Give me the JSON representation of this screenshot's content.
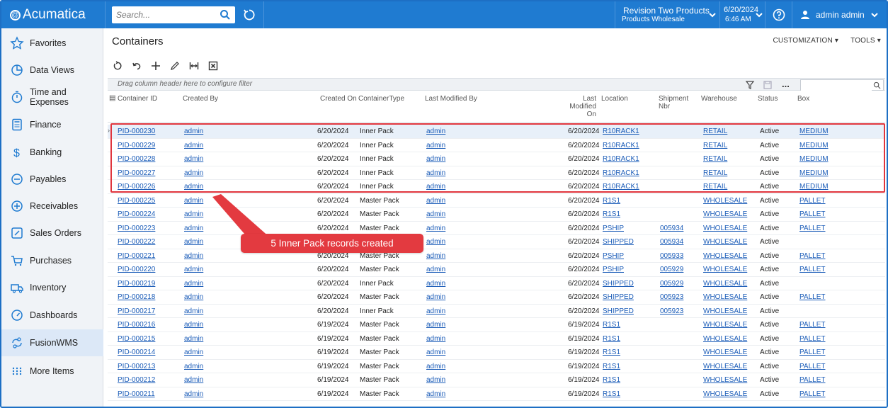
{
  "app": {
    "logo_text": "Acumatica"
  },
  "topbar": {
    "search_placeholder": "Search...",
    "company_line1": "Revision Two Products",
    "company_line2": "Products Wholesale",
    "date": "6/20/2024",
    "time": "6:46 AM",
    "user": "admin admin"
  },
  "sidebar": {
    "items": [
      {
        "label": "Favorites",
        "icon": "star-icon"
      },
      {
        "label": "Data Views",
        "icon": "pie-chart-icon"
      },
      {
        "label": "Time and Expenses",
        "icon": "stopwatch-icon"
      },
      {
        "label": "Finance",
        "icon": "calculator-icon"
      },
      {
        "label": "Banking",
        "icon": "dollar-icon"
      },
      {
        "label": "Payables",
        "icon": "minus-circle-icon"
      },
      {
        "label": "Receivables",
        "icon": "plus-circle-icon"
      },
      {
        "label": "Sales Orders",
        "icon": "pencil-icon"
      },
      {
        "label": "Purchases",
        "icon": "cart-icon"
      },
      {
        "label": "Inventory",
        "icon": "truck-icon"
      },
      {
        "label": "Dashboards",
        "icon": "gauge-icon"
      },
      {
        "label": "FusionWMS",
        "icon": "wms-icon"
      },
      {
        "label": "More Items",
        "icon": "grid-dots-icon"
      }
    ],
    "active": "FusionWMS"
  },
  "page": {
    "title": "Containers",
    "customization": "CUSTOMIZATION ▾",
    "tools": "TOOLS ▾",
    "filter_hint": "Drag column header here to configure filter",
    "more": "..."
  },
  "columns": {
    "container_id": "Container ID",
    "created_by": "Created By",
    "created_on": "Created On",
    "container_type": "ContainerType",
    "last_modified_by": "Last Modified By",
    "last_modified_on_1": "Last",
    "last_modified_on_2": "Modified",
    "last_modified_on_3": "On",
    "location": "Location",
    "shipment_nbr_1": "Shipment",
    "shipment_nbr_2": "Nbr",
    "warehouse": "Warehouse",
    "status": "Status",
    "box": "Box"
  },
  "rows": [
    {
      "id": "PID-000230",
      "created_by": "admin",
      "created_on": "6/20/2024",
      "type": "Inner Pack",
      "modified_by": "admin",
      "modified_on": "6/20/2024",
      "location": "R10RACK1",
      "shipment": "",
      "warehouse": "RETAIL",
      "status": "Active",
      "box": "MEDIUM"
    },
    {
      "id": "PID-000229",
      "created_by": "admin",
      "created_on": "6/20/2024",
      "type": "Inner Pack",
      "modified_by": "admin",
      "modified_on": "6/20/2024",
      "location": "R10RACK1",
      "shipment": "",
      "warehouse": "RETAIL",
      "status": "Active",
      "box": "MEDIUM"
    },
    {
      "id": "PID-000228",
      "created_by": "admin",
      "created_on": "6/20/2024",
      "type": "Inner Pack",
      "modified_by": "admin",
      "modified_on": "6/20/2024",
      "location": "R10RACK1",
      "shipment": "",
      "warehouse": "RETAIL",
      "status": "Active",
      "box": "MEDIUM"
    },
    {
      "id": "PID-000227",
      "created_by": "admin",
      "created_on": "6/20/2024",
      "type": "Inner Pack",
      "modified_by": "admin",
      "modified_on": "6/20/2024",
      "location": "R10RACK1",
      "shipment": "",
      "warehouse": "RETAIL",
      "status": "Active",
      "box": "MEDIUM"
    },
    {
      "id": "PID-000226",
      "created_by": "admin",
      "created_on": "6/20/2024",
      "type": "Inner Pack",
      "modified_by": "admin",
      "modified_on": "6/20/2024",
      "location": "R10RACK1",
      "shipment": "",
      "warehouse": "RETAIL",
      "status": "Active",
      "box": "MEDIUM"
    },
    {
      "id": "PID-000225",
      "created_by": "admin",
      "created_on": "6/20/2024",
      "type": "Master Pack",
      "modified_by": "admin",
      "modified_on": "6/20/2024",
      "location": "R1S1",
      "shipment": "",
      "warehouse": "WHOLESALE",
      "status": "Active",
      "box": "PALLET"
    },
    {
      "id": "PID-000224",
      "created_by": "admin",
      "created_on": "6/20/2024",
      "type": "Master Pack",
      "modified_by": "admin",
      "modified_on": "6/20/2024",
      "location": "R1S1",
      "shipment": "",
      "warehouse": "WHOLESALE",
      "status": "Active",
      "box": "PALLET"
    },
    {
      "id": "PID-000223",
      "created_by": "admin",
      "created_on": "6/20/2024",
      "type": "Master Pack",
      "modified_by": "admin",
      "modified_on": "6/20/2024",
      "location": "PSHIP",
      "shipment": "005934",
      "warehouse": "WHOLESALE",
      "status": "Active",
      "box": "PALLET"
    },
    {
      "id": "PID-000222",
      "created_by": "admin",
      "created_on": "6/20/2024",
      "type": "Master Pack",
      "modified_by": "admin",
      "modified_on": "6/20/2024",
      "location": "SHIPPED",
      "shipment": "005934",
      "warehouse": "WHOLESALE",
      "status": "Active",
      "box": ""
    },
    {
      "id": "PID-000221",
      "created_by": "admin",
      "created_on": "6/20/2024",
      "type": "Master Pack",
      "modified_by": "admin",
      "modified_on": "6/20/2024",
      "location": "PSHIP",
      "shipment": "005933",
      "warehouse": "WHOLESALE",
      "status": "Active",
      "box": "PALLET"
    },
    {
      "id": "PID-000220",
      "created_by": "admin",
      "created_on": "6/20/2024",
      "type": "Master Pack",
      "modified_by": "admin",
      "modified_on": "6/20/2024",
      "location": "PSHIP",
      "shipment": "005929",
      "warehouse": "WHOLESALE",
      "status": "Active",
      "box": "PALLET"
    },
    {
      "id": "PID-000219",
      "created_by": "admin",
      "created_on": "6/20/2024",
      "type": "Inner Pack",
      "modified_by": "admin",
      "modified_on": "6/20/2024",
      "location": "SHIPPED",
      "shipment": "005929",
      "warehouse": "WHOLESALE",
      "status": "Active",
      "box": ""
    },
    {
      "id": "PID-000218",
      "created_by": "admin",
      "created_on": "6/20/2024",
      "type": "Master Pack",
      "modified_by": "admin",
      "modified_on": "6/20/2024",
      "location": "SHIPPED",
      "shipment": "005923",
      "warehouse": "WHOLESALE",
      "status": "Active",
      "box": "PALLET"
    },
    {
      "id": "PID-000217",
      "created_by": "admin",
      "created_on": "6/20/2024",
      "type": "Inner Pack",
      "modified_by": "admin",
      "modified_on": "6/20/2024",
      "location": "SHIPPED",
      "shipment": "005923",
      "warehouse": "WHOLESALE",
      "status": "Active",
      "box": ""
    },
    {
      "id": "PID-000216",
      "created_by": "admin",
      "created_on": "6/19/2024",
      "type": "Master Pack",
      "modified_by": "admin",
      "modified_on": "6/19/2024",
      "location": "R1S1",
      "shipment": "",
      "warehouse": "WHOLESALE",
      "status": "Active",
      "box": "PALLET"
    },
    {
      "id": "PID-000215",
      "created_by": "admin",
      "created_on": "6/19/2024",
      "type": "Master Pack",
      "modified_by": "admin",
      "modified_on": "6/19/2024",
      "location": "R1S1",
      "shipment": "",
      "warehouse": "WHOLESALE",
      "status": "Active",
      "box": "PALLET"
    },
    {
      "id": "PID-000214",
      "created_by": "admin",
      "created_on": "6/19/2024",
      "type": "Master Pack",
      "modified_by": "admin",
      "modified_on": "6/19/2024",
      "location": "R1S1",
      "shipment": "",
      "warehouse": "WHOLESALE",
      "status": "Active",
      "box": "PALLET"
    },
    {
      "id": "PID-000213",
      "created_by": "admin",
      "created_on": "6/19/2024",
      "type": "Master Pack",
      "modified_by": "admin",
      "modified_on": "6/19/2024",
      "location": "R1S1",
      "shipment": "",
      "warehouse": "WHOLESALE",
      "status": "Active",
      "box": "PALLET"
    },
    {
      "id": "PID-000212",
      "created_by": "admin",
      "created_on": "6/19/2024",
      "type": "Master Pack",
      "modified_by": "admin",
      "modified_on": "6/19/2024",
      "location": "R1S1",
      "shipment": "",
      "warehouse": "WHOLESALE",
      "status": "Active",
      "box": "PALLET"
    },
    {
      "id": "PID-000211",
      "created_by": "admin",
      "created_on": "6/19/2024",
      "type": "Master Pack",
      "modified_by": "admin",
      "modified_on": "6/19/2024",
      "location": "R1S1",
      "shipment": "",
      "warehouse": "WHOLESALE",
      "status": "Active",
      "box": "PALLET"
    }
  ],
  "annotation": {
    "callout_text": "5 Inner Pack records created",
    "color": "#e33a40"
  },
  "colors": {
    "topbar": "#1f7bd1",
    "link": "#1b5cb8",
    "sidebar_bg": "#f0f3f7"
  }
}
